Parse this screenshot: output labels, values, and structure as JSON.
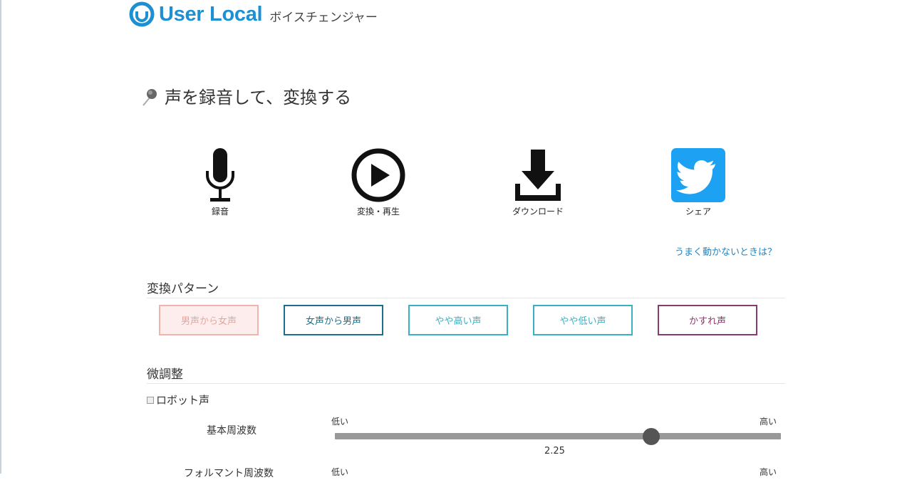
{
  "header": {
    "logo_text": "User Local",
    "app_name": "ボイスチェンジャー",
    "brand_color": "#1e8fd3"
  },
  "section": {
    "title": "声を録音して、変換する",
    "icon": "microphone-icon"
  },
  "actions": [
    {
      "label": "録音",
      "icon": "microphone-icon"
    },
    {
      "label": "変換・再生",
      "icon": "play-circle-icon"
    },
    {
      "label": "ダウンロード",
      "icon": "download-icon"
    },
    {
      "label": "シェア",
      "icon": "twitter-icon",
      "color": "#1da1f2"
    }
  ],
  "help_link": "うまく動かないときは？",
  "patterns": {
    "heading": "変換パターン",
    "buttons": [
      {
        "label": "男声から女声",
        "color": "#f0b4ae",
        "text_color": "#e8a49c",
        "bg": "#fdeeed"
      },
      {
        "label": "女声から男声",
        "color": "#1b6f8a",
        "text_color": "#1b6f8a"
      },
      {
        "label": "やや高い声",
        "color": "#3ab0c4",
        "text_color": "#3ab0c4"
      },
      {
        "label": "やや低い声",
        "color": "#3ab0c4",
        "text_color": "#3ab0c4"
      },
      {
        "label": "かすれ声",
        "color": "#8a3a6e",
        "text_color": "#8a3a6e"
      }
    ]
  },
  "fine_tune": {
    "heading": "微調整",
    "robot_label": "ロボット声",
    "robot_checked": false,
    "sliders": [
      {
        "label": "基本周波数",
        "low": "低い",
        "high": "高い",
        "value": "2.25",
        "position_fraction": 0.71
      },
      {
        "label": "フォルマント周波数",
        "low": "低い",
        "high": "高い"
      }
    ]
  }
}
